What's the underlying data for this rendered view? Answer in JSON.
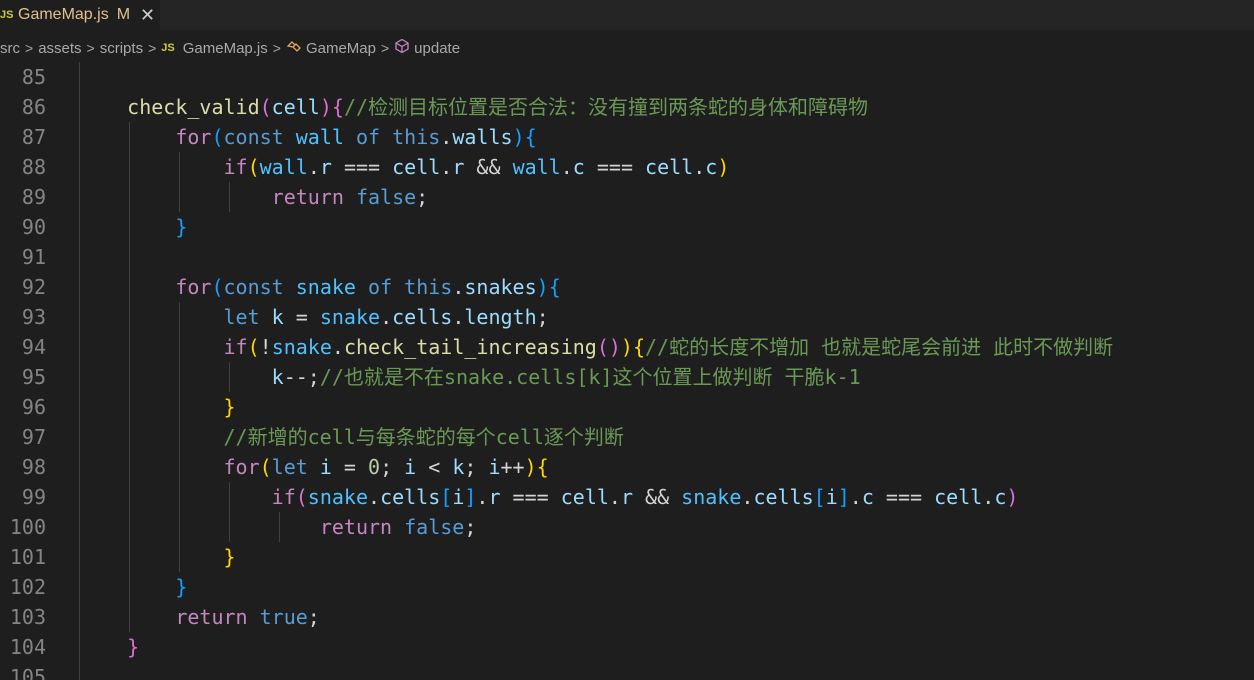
{
  "tab": {
    "icon": "JS",
    "label": "GameMap.js",
    "modified": "M",
    "close": "✕"
  },
  "breadcrumb": {
    "items": [
      "src",
      "assets",
      "scripts"
    ],
    "file_icon": "JS",
    "file": "GameMap.js",
    "class": "GameMap",
    "method": "update",
    "separator": ">"
  },
  "editor": {
    "line_numbers": [
      "85",
      "86",
      "87",
      "88",
      "89",
      "90",
      "91",
      "92",
      "93",
      "94",
      "95",
      "96",
      "97",
      "98",
      "99",
      "100",
      "101",
      "102",
      "103",
      "104",
      "105"
    ],
    "lines": [
      [],
      [
        [
          "    ",
          "op"
        ],
        [
          "check_valid",
          "fn"
        ],
        [
          "(",
          "b2"
        ],
        [
          "cell",
          "var"
        ],
        [
          ")",
          "b2"
        ],
        [
          "{",
          "b2"
        ],
        [
          "//检测目标位置是否合法：没有撞到两条蛇的身体和障碍物",
          "cm"
        ]
      ],
      [
        [
          "        ",
          "op"
        ],
        [
          "for",
          "kw"
        ],
        [
          "(",
          "b3"
        ],
        [
          "const",
          "kb"
        ],
        [
          " ",
          "op"
        ],
        [
          "wall",
          "const"
        ],
        [
          " ",
          "op"
        ],
        [
          "of",
          "kb"
        ],
        [
          " ",
          "op"
        ],
        [
          "this",
          "kb"
        ],
        [
          ".",
          "op"
        ],
        [
          "walls",
          "var"
        ],
        [
          ")",
          "b3"
        ],
        [
          "{",
          "b3"
        ]
      ],
      [
        [
          "            ",
          "op"
        ],
        [
          "if",
          "kw"
        ],
        [
          "(",
          "b1"
        ],
        [
          "wall",
          "const"
        ],
        [
          ".",
          "op"
        ],
        [
          "r",
          "var"
        ],
        [
          " === ",
          "op"
        ],
        [
          "cell",
          "var"
        ],
        [
          ".",
          "op"
        ],
        [
          "r",
          "var"
        ],
        [
          " && ",
          "op"
        ],
        [
          "wall",
          "const"
        ],
        [
          ".",
          "op"
        ],
        [
          "c",
          "var"
        ],
        [
          " === ",
          "op"
        ],
        [
          "cell",
          "var"
        ],
        [
          ".",
          "op"
        ],
        [
          "c",
          "var"
        ],
        [
          ")",
          "b1"
        ]
      ],
      [
        [
          "                ",
          "op"
        ],
        [
          "return",
          "kw"
        ],
        [
          " ",
          "op"
        ],
        [
          "false",
          "kb"
        ],
        [
          ";",
          "op"
        ]
      ],
      [
        [
          "        ",
          "op"
        ],
        [
          "}",
          "b3"
        ]
      ],
      [],
      [
        [
          "        ",
          "op"
        ],
        [
          "for",
          "kw"
        ],
        [
          "(",
          "b3"
        ],
        [
          "const",
          "kb"
        ],
        [
          " ",
          "op"
        ],
        [
          "snake",
          "const"
        ],
        [
          " ",
          "op"
        ],
        [
          "of",
          "kb"
        ],
        [
          " ",
          "op"
        ],
        [
          "this",
          "kb"
        ],
        [
          ".",
          "op"
        ],
        [
          "snakes",
          "var"
        ],
        [
          ")",
          "b3"
        ],
        [
          "{",
          "b3"
        ]
      ],
      [
        [
          "            ",
          "op"
        ],
        [
          "let",
          "kb"
        ],
        [
          " ",
          "op"
        ],
        [
          "k",
          "var"
        ],
        [
          " = ",
          "op"
        ],
        [
          "snake",
          "const"
        ],
        [
          ".",
          "op"
        ],
        [
          "cells",
          "var"
        ],
        [
          ".",
          "op"
        ],
        [
          "length",
          "var"
        ],
        [
          ";",
          "op"
        ]
      ],
      [
        [
          "            ",
          "op"
        ],
        [
          "if",
          "kw"
        ],
        [
          "(",
          "b1"
        ],
        [
          "!",
          "op"
        ],
        [
          "snake",
          "const"
        ],
        [
          ".",
          "op"
        ],
        [
          "check_tail_increasing",
          "fn"
        ],
        [
          "(",
          "b2"
        ],
        [
          ")",
          "b2"
        ],
        [
          ")",
          "b1"
        ],
        [
          "{",
          "b1"
        ],
        [
          "//蛇的长度不增加 也就是蛇尾会前进 此时不做判断",
          "cm"
        ]
      ],
      [
        [
          "                ",
          "op"
        ],
        [
          "k",
          "var"
        ],
        [
          "--;",
          "op"
        ],
        [
          "//也就是不在snake.cells[k]这个位置上做判断 干脆k-1",
          "cm"
        ]
      ],
      [
        [
          "            ",
          "op"
        ],
        [
          "}",
          "b1"
        ]
      ],
      [
        [
          "            ",
          "op"
        ],
        [
          "//新增的cell与每条蛇的每个cell逐个判断",
          "cm"
        ]
      ],
      [
        [
          "            ",
          "op"
        ],
        [
          "for",
          "kw"
        ],
        [
          "(",
          "b1"
        ],
        [
          "let",
          "kb"
        ],
        [
          " ",
          "op"
        ],
        [
          "i",
          "var"
        ],
        [
          " = ",
          "op"
        ],
        [
          "0",
          "num"
        ],
        [
          "; ",
          "op"
        ],
        [
          "i",
          "var"
        ],
        [
          " < ",
          "op"
        ],
        [
          "k",
          "var"
        ],
        [
          "; ",
          "op"
        ],
        [
          "i",
          "var"
        ],
        [
          "++",
          "op"
        ],
        [
          ")",
          "b1"
        ],
        [
          "{",
          "b1"
        ]
      ],
      [
        [
          "                ",
          "op"
        ],
        [
          "if",
          "kw"
        ],
        [
          "(",
          "b2"
        ],
        [
          "snake",
          "const"
        ],
        [
          ".",
          "op"
        ],
        [
          "cells",
          "var"
        ],
        [
          "[",
          "b3"
        ],
        [
          "i",
          "var"
        ],
        [
          "]",
          "b3"
        ],
        [
          ".",
          "op"
        ],
        [
          "r",
          "var"
        ],
        [
          " === ",
          "op"
        ],
        [
          "cell",
          "var"
        ],
        [
          ".",
          "op"
        ],
        [
          "r",
          "var"
        ],
        [
          " && ",
          "op"
        ],
        [
          "snake",
          "const"
        ],
        [
          ".",
          "op"
        ],
        [
          "cells",
          "var"
        ],
        [
          "[",
          "b3"
        ],
        [
          "i",
          "var"
        ],
        [
          "]",
          "b3"
        ],
        [
          ".",
          "op"
        ],
        [
          "c",
          "var"
        ],
        [
          " === ",
          "op"
        ],
        [
          "cell",
          "var"
        ],
        [
          ".",
          "op"
        ],
        [
          "c",
          "var"
        ],
        [
          ")",
          "b2"
        ]
      ],
      [
        [
          "                    ",
          "op"
        ],
        [
          "return",
          "kw"
        ],
        [
          " ",
          "op"
        ],
        [
          "false",
          "kb"
        ],
        [
          ";",
          "op"
        ]
      ],
      [
        [
          "            ",
          "op"
        ],
        [
          "}",
          "b1"
        ]
      ],
      [
        [
          "        ",
          "op"
        ],
        [
          "}",
          "b3"
        ]
      ],
      [
        [
          "        ",
          "op"
        ],
        [
          "return",
          "kw"
        ],
        [
          " ",
          "op"
        ],
        [
          "true",
          "kb"
        ],
        [
          ";",
          "op"
        ]
      ],
      [
        [
          "    ",
          "op"
        ],
        [
          "}",
          "b2"
        ]
      ],
      []
    ]
  },
  "icons": {
    "js_icon": "JS",
    "class_icon": "class-icon",
    "method_icon": "method-icon"
  },
  "colors": {
    "background": "#1e1e1e",
    "comment": "#6a9955",
    "keyword_control": "#c586c0",
    "keyword": "#569cd6",
    "function": "#dcdcaa",
    "variable": "#9cdcfe",
    "constant": "#4fc1ff",
    "number": "#b5cea8",
    "modified": "#e2c08d"
  }
}
